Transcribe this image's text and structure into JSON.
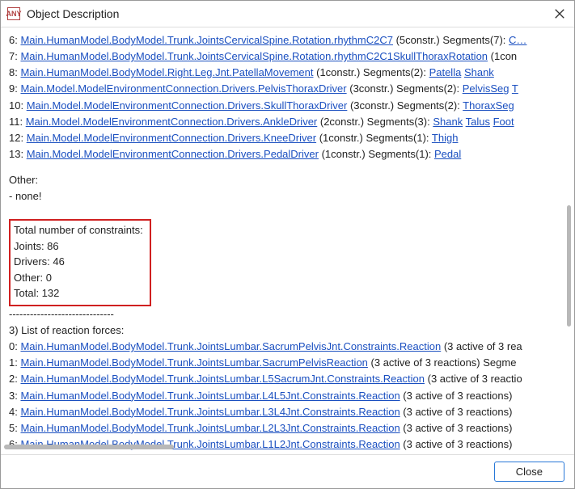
{
  "window": {
    "title": "Object Description",
    "icon_text": "ANY"
  },
  "lines_top": [
    {
      "idx": "6:",
      "link": "Main.HumanModel.BodyModel.Trunk.JointsCervicalSpine.Rotation.rhythmC2C7",
      "trail": " (5constr.)  Segments(7): ",
      "extra_link": "C…"
    },
    {
      "idx": "7:",
      "link": "Main.HumanModel.BodyModel.Trunk.JointsCervicalSpine.Rotation.rhythmC2C1SkullThoraxRotation",
      "trail": " (1con"
    },
    {
      "idx": "8:",
      "link": "Main.HumanModel.BodyModel.Right.Leg.Jnt.PatellaMovement",
      "trail": " (1constr.)  Segments(2): ",
      "extra_link": "Patella",
      "extra_link2": "Shank"
    },
    {
      "idx": "9:",
      "link": "Main.Model.ModelEnvironmentConnection.Drivers.PelvisThoraxDriver",
      "trail": " (3constr.)  Segments(2): ",
      "extra_link": "PelvisSeg",
      "extra_link2": "T"
    },
    {
      "idx": "10:",
      "link": "Main.Model.ModelEnvironmentConnection.Drivers.SkullThoraxDriver",
      "trail": " (3constr.)  Segments(2): ",
      "extra_link": "ThoraxSeg"
    },
    {
      "idx": "11:",
      "link": "Main.Model.ModelEnvironmentConnection.Drivers.AnkleDriver",
      "trail": " (2constr.)  Segments(3): ",
      "extra_link": "Shank",
      "extra_link2": "Talus",
      "extra_link3": "Foot"
    },
    {
      "idx": "12:",
      "link": "Main.Model.ModelEnvironmentConnection.Drivers.KneeDriver",
      "trail": " (1constr.)  Segments(1): ",
      "extra_link": "Thigh"
    },
    {
      "idx": "13:",
      "link": "Main.Model.ModelEnvironmentConnection.Drivers.PedalDriver",
      "trail": " (1constr.)  Segments(1): ",
      "extra_link": "Pedal"
    }
  ],
  "other": {
    "header": "Other:",
    "none": "- none!"
  },
  "totals": {
    "header": "Total number of constraints:",
    "joints": "Joints:  86",
    "drivers": "Drivers: 46",
    "other": "Other:   0",
    "total": "Total:   132"
  },
  "dashes": "------------------------------",
  "section3": "3) List of reaction forces:",
  "lines_bottom": [
    {
      "idx": "0:",
      "link": "Main.HumanModel.BodyModel.Trunk.JointsLumbar.SacrumPelvisJnt.Constraints.Reaction",
      "trail": " (3 active of 3 rea"
    },
    {
      "idx": "1:",
      "link": "Main.HumanModel.BodyModel.Trunk.JointsLumbar.SacrumPelvisReaction",
      "trail": " (3 active of 3 reactions)  Segme"
    },
    {
      "idx": "2:",
      "link": "Main.HumanModel.BodyModel.Trunk.JointsLumbar.L5SacrumJnt.Constraints.Reaction",
      "trail": " (3 active of 3 reactio"
    },
    {
      "idx": "3:",
      "link": "Main.HumanModel.BodyModel.Trunk.JointsLumbar.L4L5Jnt.Constraints.Reaction",
      "trail": " (3 active of 3 reactions)  "
    },
    {
      "idx": "4:",
      "link": "Main.HumanModel.BodyModel.Trunk.JointsLumbar.L3L4Jnt.Constraints.Reaction",
      "trail": " (3 active of 3 reactions)  "
    },
    {
      "idx": "5:",
      "link": "Main.HumanModel.BodyModel.Trunk.JointsLumbar.L2L3Jnt.Constraints.Reaction",
      "trail": " (3 active of 3 reactions)  "
    },
    {
      "idx": "6:",
      "link": "Main.HumanModel.BodyModel.Trunk.JointsLumbar.L1L2Jnt.Constraints.Reaction",
      "trail": " (3 active of 3 reactions)  "
    }
  ],
  "footer": {
    "close_label": "Close"
  }
}
